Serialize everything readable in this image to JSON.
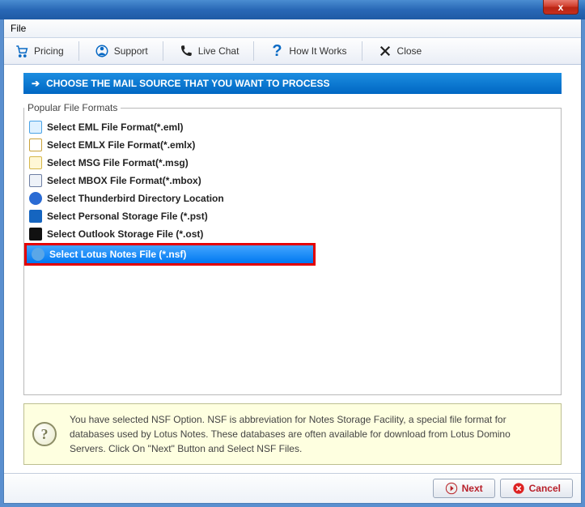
{
  "titlebar": {
    "close_symbol": "x"
  },
  "menubar": {
    "file": "File"
  },
  "toolbar": {
    "pricing": "Pricing",
    "support": "Support",
    "livechat": "Live Chat",
    "how": "How It Works",
    "close": "Close"
  },
  "header": {
    "arrow": "➔",
    "title": "CHOOSE THE MAIL SOURCE THAT YOU WANT TO PROCESS"
  },
  "formats": {
    "legend": "Popular File Formats",
    "items": [
      {
        "label": "Select EML File Format(*.eml)",
        "selected": false,
        "highlighted": false
      },
      {
        "label": "Select EMLX File Format(*.emlx)",
        "selected": false,
        "highlighted": false
      },
      {
        "label": "Select MSG File Format(*.msg)",
        "selected": false,
        "highlighted": false
      },
      {
        "label": "Select MBOX File Format(*.mbox)",
        "selected": false,
        "highlighted": false
      },
      {
        "label": "Select Thunderbird Directory Location",
        "selected": false,
        "highlighted": false
      },
      {
        "label": "Select Personal Storage File (*.pst)",
        "selected": false,
        "highlighted": false
      },
      {
        "label": "Select Outlook Storage File (*.ost)",
        "selected": false,
        "highlighted": false
      },
      {
        "label": "Select Lotus Notes File (*.nsf)",
        "selected": true,
        "highlighted": true
      }
    ]
  },
  "info": {
    "symbol": "?",
    "text": "You have selected NSF Option. NSF is abbreviation for Notes Storage Facility, a special file format for databases used by Lotus Notes. These databases are often available for download from Lotus Domino Servers. Click On \"Next\" Button and Select NSF Files."
  },
  "footer": {
    "next": "Next",
    "cancel": "Cancel"
  }
}
